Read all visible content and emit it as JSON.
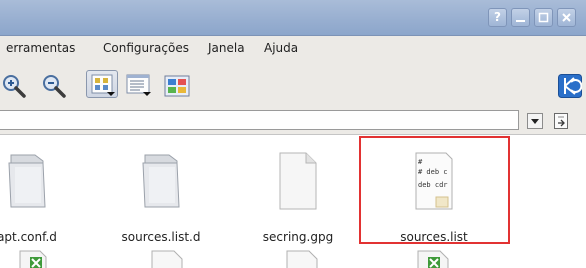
{
  "window": {
    "buttons": [
      {
        "name": "help",
        "label": "?"
      },
      {
        "name": "minimize",
        "label": ""
      },
      {
        "name": "maximize",
        "label": ""
      },
      {
        "name": "close",
        "label": ""
      }
    ]
  },
  "menubar": {
    "items": [
      {
        "label": "erramentas"
      },
      {
        "label": "Configurações"
      },
      {
        "label": "Janela"
      },
      {
        "label": "Ajuda"
      }
    ]
  },
  "toolbar": {
    "icons": [
      "zoom-in-icon",
      "zoom-out-icon",
      "icon-view-icon",
      "detail-view-icon",
      "preview-icon",
      "kde-logo-icon"
    ]
  },
  "location": {
    "value": ""
  },
  "files": [
    {
      "name": "apt.conf.d",
      "type": "folder"
    },
    {
      "name": "sources.list.d",
      "type": "folder"
    },
    {
      "name": "secring.gpg",
      "type": "file"
    },
    {
      "name": "sources.list",
      "type": "text-file",
      "preview_lines": [
        "#",
        "# deb c",
        "deb cdr"
      ]
    }
  ],
  "colors": {
    "highlight": "#e23232",
    "titlebar": "#97aed0"
  }
}
